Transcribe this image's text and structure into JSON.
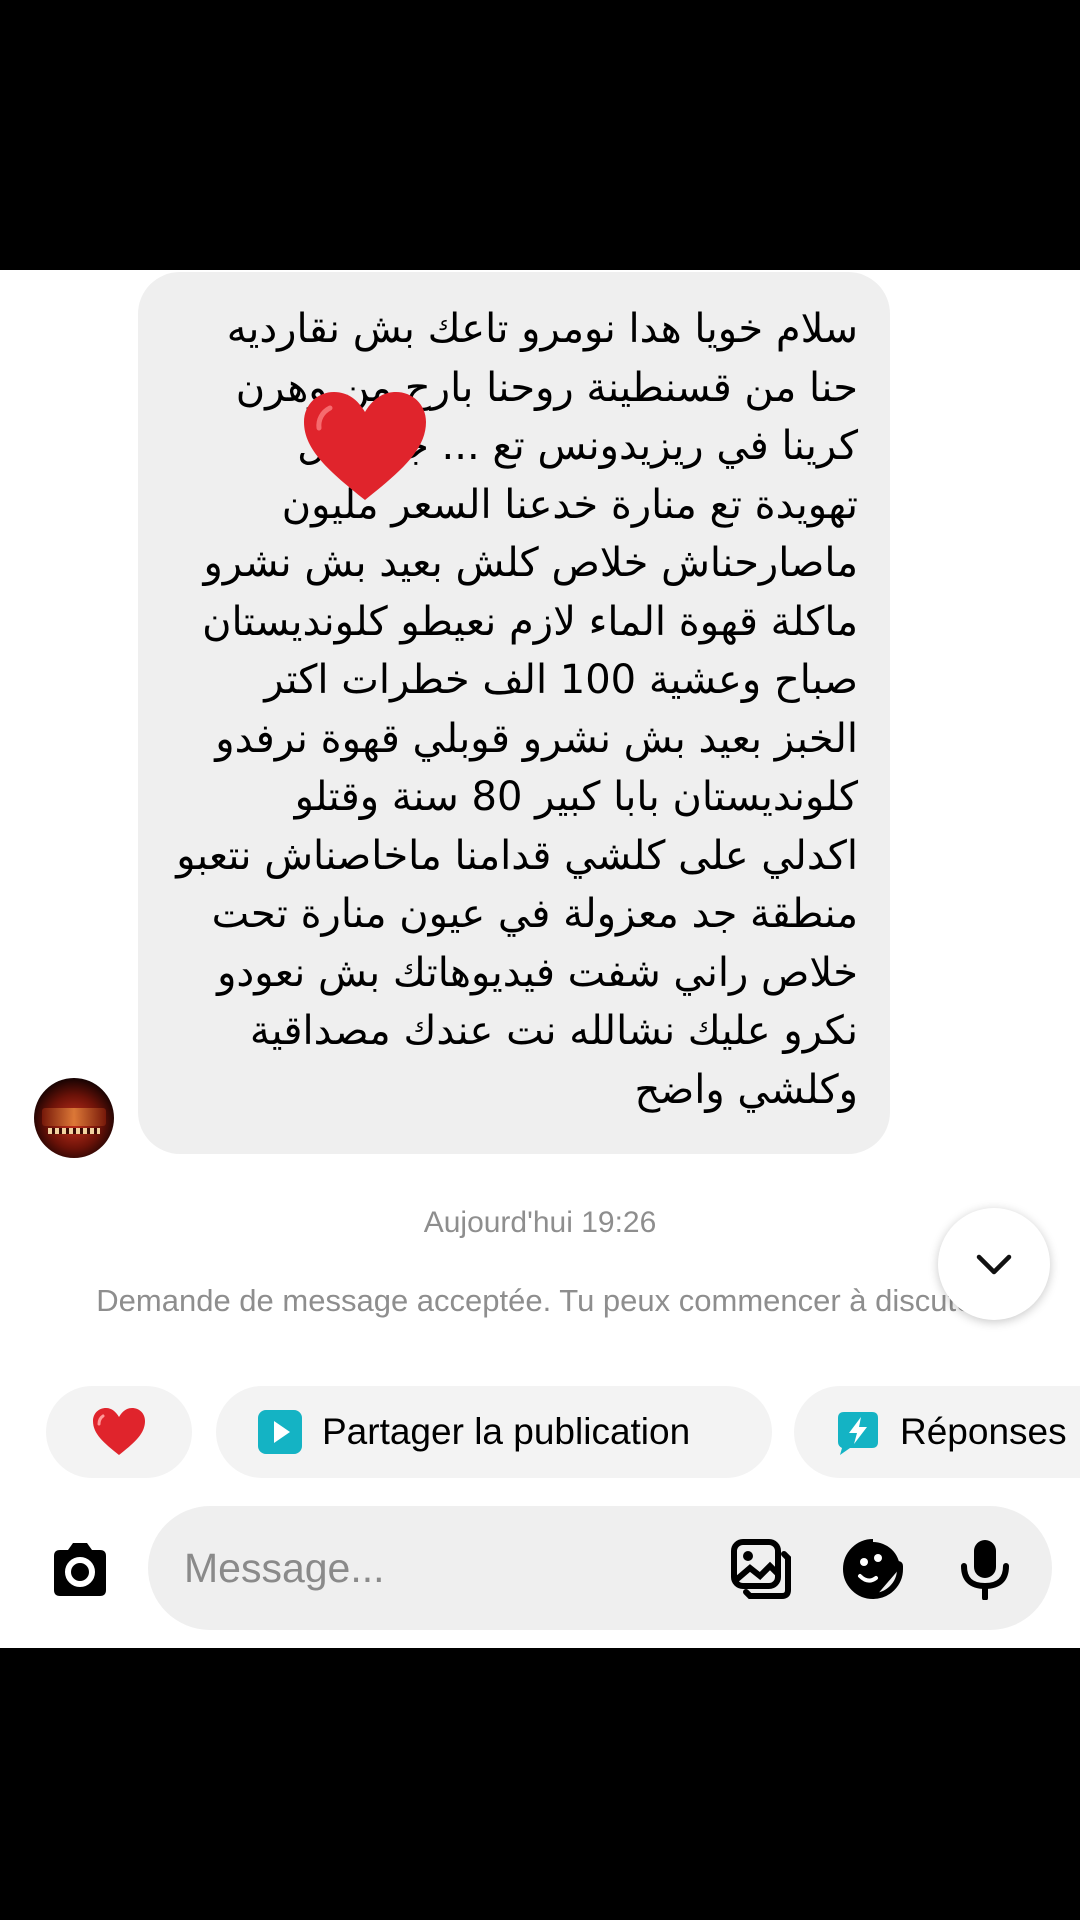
{
  "conversation": {
    "message": {
      "lines": [
        "سلام خويا هدا نومرو تاعك بش نقارديه",
        "حنا من قسنطينة روحنا بارح من وهرن",
        "كرينا في ريزيدونس تع ... جاية فل",
        "تهويدة تع منارة خدعنا السعر مليون",
        "ماصارحناش خلاص كلش بعيد بش نشرو",
        "ماكلة قهوة الماء لازم نعيطو كلونديستان",
        "صباح وعشية 100 الف خطرات اكتر",
        "الخبز بعيد بش نشرو قوبلي قهوة نرفدو",
        "كلونديستان بابا كبير 80 سنة وقتلو",
        "اكدلي على كلشي قدامنا ماخاصناش نتعبو",
        "منطقة جد معزولة في عيون منارة تحت",
        "خلاص راني شفت فيديوهاتك بش نعودو",
        "نكرو عليك نشالله نت عندك مصداقية",
        "وكلشي واضح"
      ],
      "reaction": "heart-sticker",
      "bubble_color": "#efefef"
    },
    "timestamp": "Aujourd'hui 19:26",
    "notice": "Demande de message acceptée. Tu peux commencer à discuter"
  },
  "quick_actions": {
    "heart_emoji": "❤️",
    "share_label": "Partager la publication",
    "replies_label": "Réponses"
  },
  "composer": {
    "placeholder": "Message..."
  },
  "colors": {
    "accent_teal": "#14b3c4",
    "heart_red": "#e0242c",
    "muted_text": "#8e8e8e"
  }
}
